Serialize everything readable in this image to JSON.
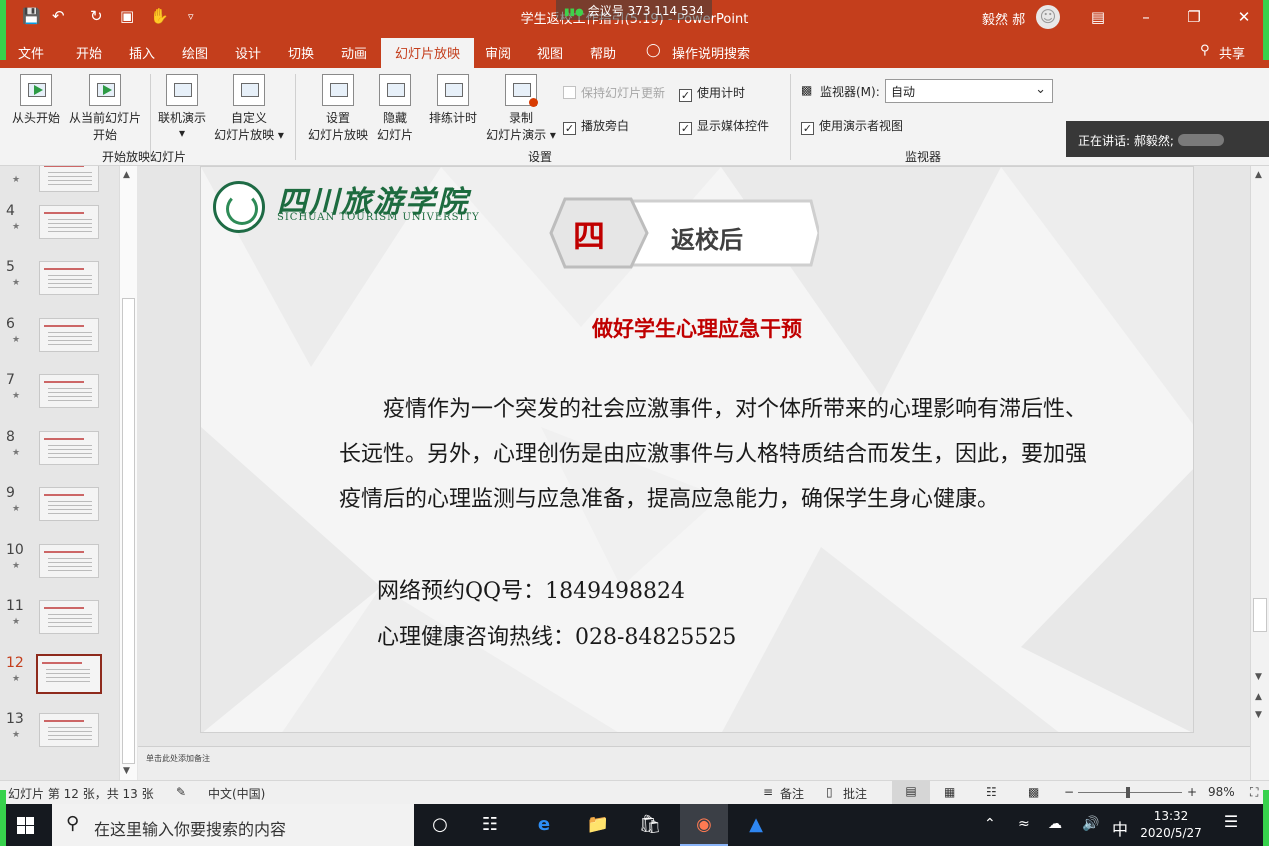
{
  "window": {
    "title": "学生返校工作指引(5.19) - PowerPoint",
    "meeting": "会议号 373 114 534",
    "user": "毅然 郝"
  },
  "tabs": [
    "文件",
    "开始",
    "插入",
    "绘图",
    "设计",
    "切换",
    "动画",
    "幻灯片放映",
    "审阅",
    "视图",
    "帮助",
    "操作说明搜索"
  ],
  "share_label": "共享",
  "ribbon": {
    "from_start_1": "从头开始",
    "from_current_1": "从当前幻灯片",
    "from_current_2": "开始",
    "online_1": "联机演示",
    "online_2": "▾",
    "custom_1": "自定义",
    "custom_2": "幻灯片放映 ▾",
    "group_start": "开始放映幻灯片",
    "setup_1": "设置",
    "setup_2": "幻灯片放映",
    "hide_1": "隐藏",
    "hide_2": "幻灯片",
    "rehearse_1": "排练计时",
    "record_1": "录制",
    "record_2": "幻灯片演示 ▾",
    "keep_updated": "保持幻灯片更新",
    "use_timings": "使用计时",
    "play_narrations": "播放旁白",
    "show_media": "显示媒体控件",
    "group_setup": "设置",
    "monitor_label": "监视器(M):",
    "monitor_value": "自动",
    "presenter_view": "使用演示者视图",
    "group_monitor": "监视器"
  },
  "speaking": "正在讲话: 郝毅然;",
  "thumbnails": [
    "4",
    "5",
    "6",
    "7",
    "8",
    "9",
    "10",
    "11",
    "12",
    "13"
  ],
  "active_slide": "12",
  "slide": {
    "school_cn": "四川旅游学院",
    "school_en": "SICHUAN TOURISM UNIVERSITY",
    "section_num": "四",
    "section_title": "返校后",
    "heading": "做好学生心理应急干预",
    "paragraph": "疫情作为一个突发的社会应激事件，对个体所带来的心理影响有滞后性、长远性。另外，心理创伤是由应激事件与人格特质结合而发生，因此，要加强疫情后的心理监测与应急准备，提高应急能力，确保学生身心健康。",
    "qq_line": "网络预约QQ号：1849498824",
    "hotline": "心理健康咨询热线：028-84825525"
  },
  "notes_placeholder": "单击此处添加备注",
  "status": {
    "slide_info": "幻灯片 第 12 张，共 13 张",
    "language": "中文(中国)",
    "notes": "备注",
    "comments": "批注",
    "zoom": "98%",
    "zoom_minus": "−",
    "zoom_plus": "+"
  },
  "taskbar": {
    "search_placeholder": "在这里输入你要搜索的内容",
    "ime": "中",
    "time": "13:32",
    "date": "2020/5/27"
  },
  "colors": {
    "accent": "#c43e1c",
    "slide_red": "#c00000",
    "school_green": "#1d6b3f",
    "share_frame": "#37d24c"
  }
}
